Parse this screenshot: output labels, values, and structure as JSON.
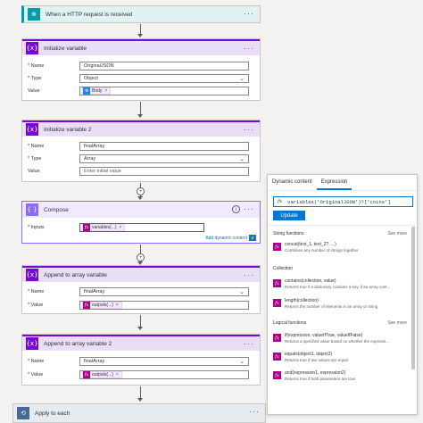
{
  "trigger": {
    "title": "When a HTTP request is received",
    "icon": "http-request-icon",
    "color": "#009da5"
  },
  "init_var1": {
    "title": "Initialize variable",
    "name_label": "* Name",
    "name_value": "OriginalJSON",
    "type_label": "* Type",
    "type_value": "Object",
    "value_label": "Value",
    "value_token": "Body"
  },
  "init_var2": {
    "title": "Initialize variable 2",
    "name_label": "* Name",
    "name_value": "finalArray",
    "type_label": "* Type",
    "type_value": "Array",
    "value_label": "Value",
    "value_placeholder": "Enter initial value"
  },
  "compose": {
    "title": "Compose",
    "inputs_label": "* Inputs",
    "inputs_token": "variables(...)",
    "add_dynamic": "Add dynamic content",
    "color": "#8c6cff"
  },
  "append1": {
    "title": "Append to array variable",
    "name_label": "* Name",
    "name_value": "finalArray",
    "value_label": "* Value",
    "value_token": "outputs(...)"
  },
  "append2": {
    "title": "Append to array variable 2",
    "name_label": "* Name",
    "name_value": "finalArray",
    "value_label": "* Value",
    "value_token": "outputs(...)"
  },
  "apply_each": {
    "title": "Apply to each",
    "color": "#486991"
  },
  "panel": {
    "tab_dynamic": "Dynamic content",
    "tab_expression": "Expression",
    "expression": "variables('OriginalJSON')?['coins']",
    "fx": "fx",
    "update": "Update",
    "see_more": "See more",
    "sections": [
      {
        "title": "String functions",
        "items": [
          {
            "name": "concat(text_1, text_2?, ...)",
            "desc": "Combines any number of strings together"
          }
        ]
      },
      {
        "title": "Collection",
        "items": [
          {
            "name": "contains(collection, value)",
            "desc": "Returns true if a dictionary contains a key, if an array cont..."
          },
          {
            "name": "length(collection)",
            "desc": "Returns the number of elements in an array or string"
          }
        ]
      },
      {
        "title": "Logical functions",
        "items": [
          {
            "name": "if(expression, valueIfTrue, valueIfFalse)",
            "desc": "Returns a specified value based on whether the expressi..."
          },
          {
            "name": "equals(object1, object2)",
            "desc": "Returns true if two values are equal"
          },
          {
            "name": "and(expression1, expression2)",
            "desc": "Returns true if both parameters are true"
          }
        ]
      }
    ]
  },
  "accent": "#770bd6"
}
